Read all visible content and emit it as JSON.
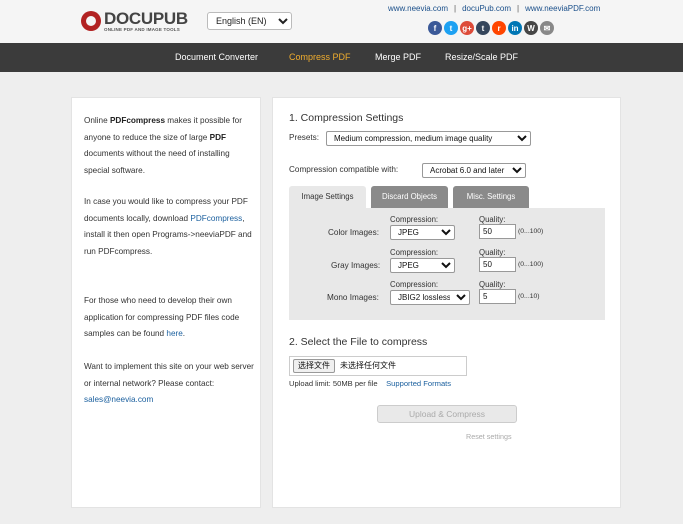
{
  "header": {
    "logo_name": "DOCUPUB",
    "logo_tagline": "ONLINE PDF AND IMAGE TOOLS",
    "language": "English (EN)",
    "links": [
      "www.neevia.com",
      "docuPub.com",
      "www.neeviaPDF.com"
    ],
    "social": [
      {
        "icon": "facebook-icon",
        "glyph": "f",
        "color": "#3b5998"
      },
      {
        "icon": "twitter-icon",
        "glyph": "t",
        "color": "#1da1f2"
      },
      {
        "icon": "google-plus-icon",
        "glyph": "g+",
        "color": "#dd4b39"
      },
      {
        "icon": "tumblr-icon",
        "glyph": "t",
        "color": "#35465c"
      },
      {
        "icon": "reddit-icon",
        "glyph": "r",
        "color": "#ff4500"
      },
      {
        "icon": "linkedin-icon",
        "glyph": "in",
        "color": "#0077b5"
      },
      {
        "icon": "wordpress-icon",
        "glyph": "W",
        "color": "#464646"
      },
      {
        "icon": "email-icon",
        "glyph": "✉",
        "color": "#888888"
      }
    ]
  },
  "nav": {
    "items": [
      "Document Converter",
      "Compress PDF",
      "Merge PDF",
      "Resize/Scale PDF"
    ],
    "active": "Compress PDF"
  },
  "sidebar": {
    "p1_pre": "Online ",
    "p1_bold1": "PDFcompress",
    "p1_mid": " makes it possible for anyone to reduce the size of large ",
    "p1_bold2": "PDF",
    "p1_post": " documents without the need of installing special software.",
    "p2_pre": "In case you would like to compress your PDF documents locally, download ",
    "p2_link": "PDFcompress",
    "p2_post": ", install it then open Programs->neeviaPDF and run PDFcompress.",
    "p3_pre": "For those who need to develop their own application for compressing PDF files code samples can be found ",
    "p3_link": "here",
    "p3_post": ".",
    "p4_pre": "Want to implement this site on your web server or internal network? Please contact: ",
    "p4_link": "sales@neevia.com"
  },
  "settings": {
    "title": "1. Compression Settings",
    "presets_label": "Presets:",
    "presets_value": "Medium compression, medium image quality",
    "compat_label": "Compression compatible with:",
    "compat_value": "Acrobat 6.0 and later",
    "tabs": [
      "Image Settings",
      "Discard Objects",
      "Misc. Settings"
    ],
    "compression_label": "Compression:",
    "quality_label": "Quality:",
    "rows": [
      {
        "label": "Color Images:",
        "compression": "JPEG",
        "quality": "50",
        "range": "(0...100)"
      },
      {
        "label": "Gray Images:",
        "compression": "JPEG",
        "quality": "50",
        "range": "(0...100)"
      },
      {
        "label": "Mono Images:",
        "compression": "JBIG2 lossless",
        "quality": "5",
        "range": "(0...10)"
      }
    ]
  },
  "file": {
    "title": "2. Select the File to compress",
    "choose_button": "选择文件",
    "no_file": "未选择任何文件",
    "upload_limit": "Upload limit: 50MB per file",
    "supported_formats": "Supported Formats",
    "upload_button": "Upload & Compress",
    "reset": "Reset settings"
  }
}
